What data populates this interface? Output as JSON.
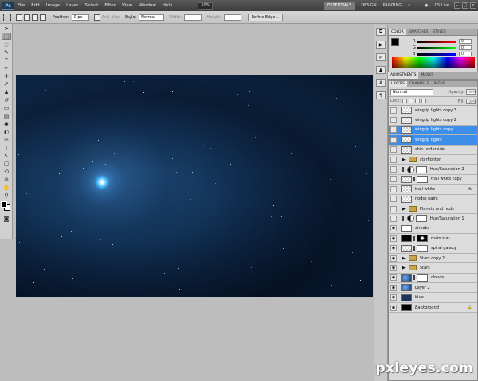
{
  "menubar": {
    "logo": "Ps",
    "items": [
      "File",
      "Edit",
      "Image",
      "Layer",
      "Select",
      "Filter",
      "View",
      "Window",
      "Help"
    ],
    "zoom": "50%",
    "workspaces": [
      "ESSENTIALS",
      "DESIGN",
      "PAINTING"
    ],
    "more": "»",
    "cslive": "CS Live",
    "window_controls": [
      "–",
      "□",
      "×"
    ]
  },
  "options": {
    "feather_label": "Feather:",
    "feather_value": "0 px",
    "antialias_label": "Anti-alias",
    "style_label": "Style:",
    "style_value": "Normal",
    "width_label": "Width:",
    "height_label": "Height:",
    "refine_edge": "Refine Edge..."
  },
  "color_panel": {
    "tabs": [
      "COLOR",
      "SWATCHES",
      "STYLES"
    ],
    "channels": [
      {
        "ch": "R",
        "value": "0",
        "color": "#d22"
      },
      {
        "ch": "G",
        "value": "0",
        "color": "#2a2"
      },
      {
        "ch": "B",
        "value": "0",
        "color": "#22c"
      }
    ]
  },
  "adjust_tabs": [
    "ADJUSTMENTS",
    "MASKS"
  ],
  "layers_panel": {
    "tabs": [
      "LAYERS",
      "CHANNELS",
      "PATHS"
    ],
    "blend_mode": "Normal",
    "opacity_label": "Opacity:",
    "opacity_value": "100%",
    "lock_label": "Lock:",
    "fill_label": "Fill:",
    "fill_value": "100%",
    "layers": [
      {
        "name": "wingtip lights copy 3",
        "eye": false,
        "thumb": "checker",
        "selected": false,
        "type": "layer"
      },
      {
        "name": "wingtip lights copy 2",
        "eye": false,
        "thumb": "checker",
        "selected": false,
        "type": "layer"
      },
      {
        "name": "wingtip lights copy",
        "eye": false,
        "thumb": "checker",
        "selected": true,
        "type": "layer"
      },
      {
        "name": "wingtip lights",
        "eye": false,
        "thumb": "checker",
        "selected": true,
        "type": "layer"
      },
      {
        "name": "ship underside",
        "eye": false,
        "thumb": "checker",
        "selected": false,
        "type": "layer"
      },
      {
        "name": "starfighter",
        "eye": false,
        "thumb": "folder",
        "selected": false,
        "type": "group"
      },
      {
        "name": "Hue/Saturation 2",
        "eye": false,
        "thumb": "adj",
        "selected": false,
        "type": "adjust"
      },
      {
        "name": "trail white copy",
        "eye": false,
        "thumb": "checker",
        "selected": false,
        "type": "masked"
      },
      {
        "name": "trail white",
        "eye": false,
        "thumb": "checker",
        "selected": false,
        "type": "layer",
        "fx": true
      },
      {
        "name": "nodss paint",
        "eye": false,
        "thumb": "checker",
        "selected": false,
        "type": "layer"
      },
      {
        "name": "Planets and nods",
        "eye": false,
        "thumb": "folder",
        "selected": false,
        "type": "group"
      },
      {
        "name": "Hue/Saturation 1",
        "eye": false,
        "thumb": "adj",
        "selected": false,
        "type": "adjust"
      },
      {
        "name": "streaks",
        "eye": true,
        "thumb": "white",
        "selected": false,
        "type": "layer"
      },
      {
        "name": "main star",
        "eye": true,
        "thumb": "dark",
        "selected": false,
        "type": "masked"
      },
      {
        "name": "spiral galaxy",
        "eye": true,
        "thumb": "checker",
        "selected": false,
        "type": "masked"
      },
      {
        "name": "Stars copy 2",
        "eye": true,
        "thumb": "folder",
        "selected": false,
        "type": "group"
      },
      {
        "name": "Stars",
        "eye": true,
        "thumb": "folder",
        "selected": false,
        "type": "group"
      },
      {
        "name": "clouds",
        "eye": true,
        "thumb": "blue",
        "selected": false,
        "type": "masked"
      },
      {
        "name": "Layer 2",
        "eye": true,
        "thumb": "blue",
        "selected": false,
        "type": "layer"
      },
      {
        "name": "blue",
        "eye": true,
        "thumb": "navy",
        "selected": false,
        "type": "layer"
      },
      {
        "name": "Background",
        "eye": true,
        "thumb": "dark",
        "selected": false,
        "type": "locked"
      }
    ]
  },
  "watermark": "pxleyes.com"
}
